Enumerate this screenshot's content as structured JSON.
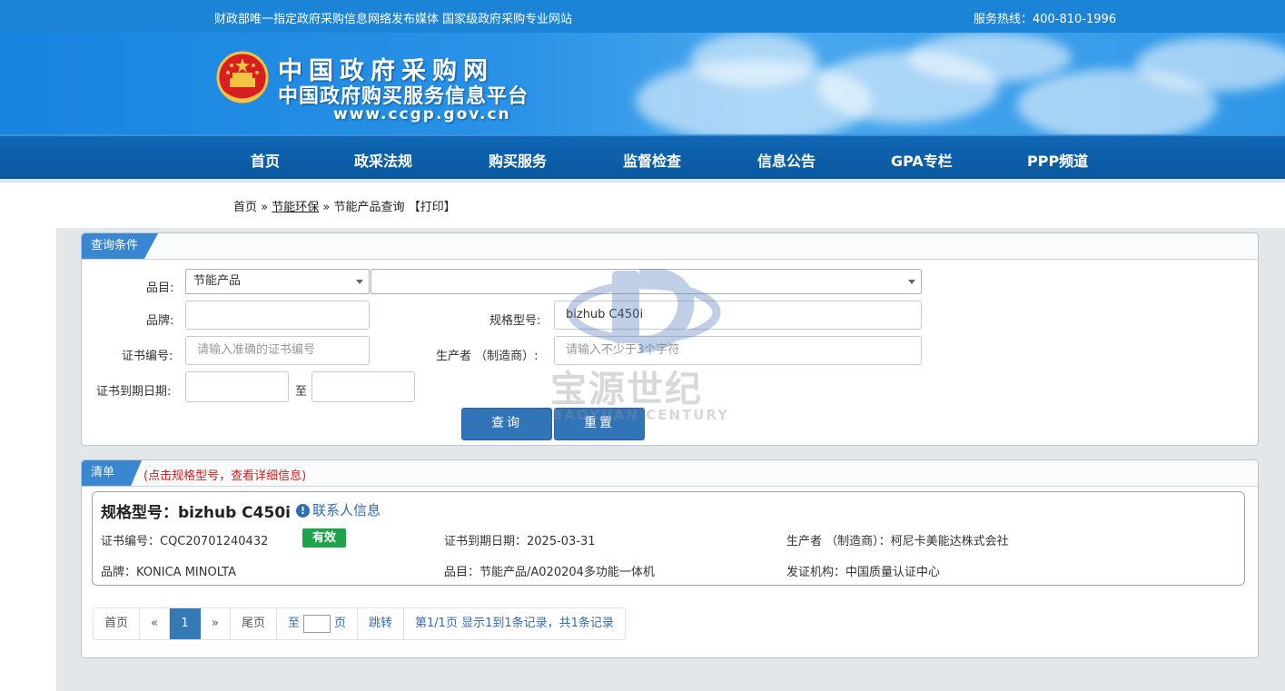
{
  "topbar": {
    "slogan": "财政部唯一指定政府采购信息网络发布媒体 国家级政府采购专业网站",
    "hotline": "服务热线：400-810-1996"
  },
  "banner": {
    "title1": "中国政府采购网",
    "title2": "中国政府购买服务信息平台",
    "url": "www.ccgp.gov.cn"
  },
  "nav": {
    "items": [
      "首页",
      "政采法规",
      "购买服务",
      "监督检查",
      "信息公告",
      "GPA专栏",
      "PPP频道"
    ]
  },
  "breadcrumb": {
    "home": "首页",
    "sep1": "»",
    "level2": "节能环保",
    "sep2": "»",
    "level3": "节能产品查询",
    "print": "【打印】"
  },
  "query": {
    "tab": "查询条件",
    "category_label": "品目:",
    "category_value": "节能产品",
    "subcategory_value": "",
    "brand_label": "品牌:",
    "brand_value": "",
    "model_label": "规格型号:",
    "model_value": "bizhub C450i",
    "cert_label": "证书编号:",
    "cert_placeholder": "请输入准确的证书编号",
    "maker_label": "生产者 （制造商）:",
    "maker_placeholder": "请输入不少于3个字符",
    "expire_label": "证书到期日期:",
    "to_label": "至",
    "search_btn": "查询",
    "reset_btn": "重置"
  },
  "list": {
    "tab": "清单",
    "hint": "(点击规格型号，查看详细信息)",
    "item": {
      "title": "规格型号：bizhub C450i",
      "contact": "联系人信息",
      "cert": "证书编号：CQC20701240432",
      "status": "有效",
      "expire": "证书到期日期：2025-03-31",
      "maker": "生产者 （制造商）：柯尼卡美能达株式会社",
      "brand": "品牌：KONICA MINOLTA",
      "category": "品目：节能产品/A020204多功能一体机",
      "issuer": "发证机构：中国质量认证中心"
    }
  },
  "pager": {
    "first": "首页",
    "prev": "«",
    "current": "1",
    "next": "»",
    "last": "尾页",
    "goto_prefix": "至",
    "goto_suffix": "页",
    "jump": "跳转",
    "summary": "第1/1页  显示1到1条记录，共1条记录"
  },
  "watermark": {
    "cn": "宝源世纪",
    "en": "BAOYUAN CENTURY"
  },
  "colors": {
    "accent": "#3274b8",
    "nav": "#0a589f",
    "status_green": "#1ea24a",
    "hint_red": "#d21f1f"
  }
}
